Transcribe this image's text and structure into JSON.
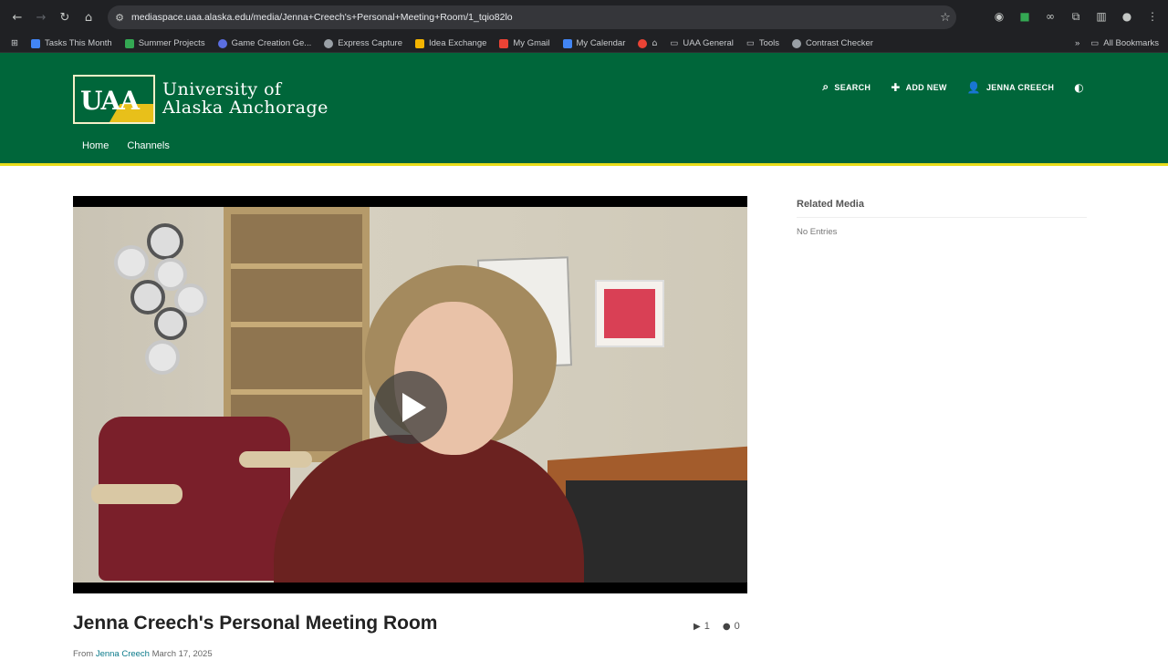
{
  "browser": {
    "url": "mediaspace.uaa.alaska.edu/media/Jenna+Creech's+Personal+Meeting+Room/1_tqio82lo",
    "bookmarks": [
      {
        "label": "Tasks This Month",
        "color": "#4285f4"
      },
      {
        "label": "Summer Projects",
        "color": "#34a853"
      },
      {
        "label": "Game Creation Ge...",
        "color": "#5b6ee1"
      },
      {
        "label": "Express Capture",
        "color": "#9aa0a6"
      },
      {
        "label": "Idea Exchange",
        "color": "#f4b400"
      },
      {
        "label": "My Gmail",
        "color": "#ea4335"
      },
      {
        "label": "My Calendar",
        "color": "#4285f4"
      },
      {
        "label": "",
        "color": "#ea4335"
      },
      {
        "label": "UAA General",
        "color": ""
      },
      {
        "label": "Tools",
        "color": ""
      },
      {
        "label": "Contrast Checker",
        "color": "#9aa0a6"
      }
    ],
    "all_bookmarks": "All Bookmarks"
  },
  "header": {
    "logo_short": "UAA",
    "logo_line1": "University of",
    "logo_line2": "Alaska Anchorage",
    "actions": {
      "search": "SEARCH",
      "add_new": "ADD NEW",
      "user": "JENNA CREECH"
    },
    "nav": [
      "Home",
      "Channels"
    ]
  },
  "media": {
    "title": "Jenna Creech's Personal Meeting Room",
    "plays": "1",
    "comments": "0",
    "byline_prefix": "From",
    "author": "Jenna Creech",
    "date": "March 17, 2025"
  },
  "sidebar": {
    "title": "Related Media",
    "empty_text": "No Entries"
  },
  "colors": {
    "brand_green": "#00663a",
    "brand_gold": "#e8dc1a"
  }
}
